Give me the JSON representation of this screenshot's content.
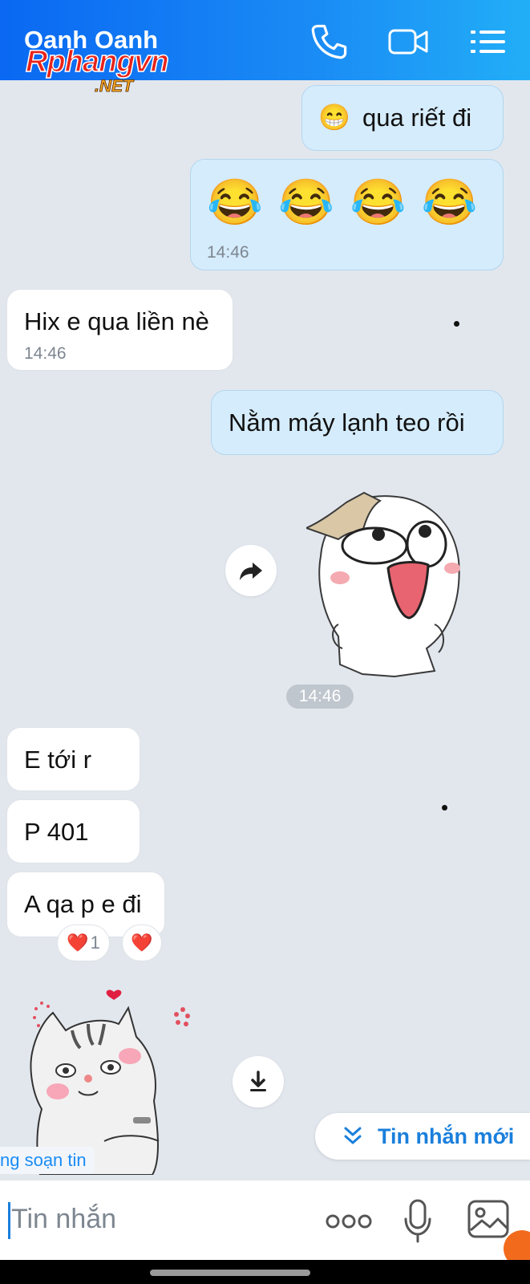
{
  "header": {
    "title": "Oanh Oanh",
    "watermark_main": "Rphangvn",
    "watermark_sub": ".NET",
    "icons": [
      "phone-icon",
      "video-call-icon",
      "menu-list-icon"
    ]
  },
  "messages": {
    "m1": {
      "emoji": "😁",
      "text": "qua riết đi"
    },
    "m2": {
      "emojis": "😂 😂 😂 😂",
      "time": "14:46"
    },
    "m3": {
      "text": "Hix e qua liền nè",
      "time": "14:46"
    },
    "m4": {
      "text": "Nằm máy lạnh teo rồi"
    },
    "sticker_time": "14:46",
    "m5": {
      "text": "E tới r"
    },
    "m6": {
      "text": "P 401"
    },
    "m7": {
      "text": "A qa p e đi"
    },
    "reaction1": {
      "emoji": "❤️",
      "count": "1"
    },
    "reaction2": {
      "emoji": "❤️"
    }
  },
  "typing_indicator": "ng soạn tin",
  "new_messages_button": "Tin nhắn mới",
  "input": {
    "placeholder": "Tin nhắn"
  },
  "colors": {
    "header_start": "#0a68f2",
    "header_end": "#22aef7",
    "outgoing_bubble": "#d5ecfc",
    "accent": "#1a7fdc"
  }
}
